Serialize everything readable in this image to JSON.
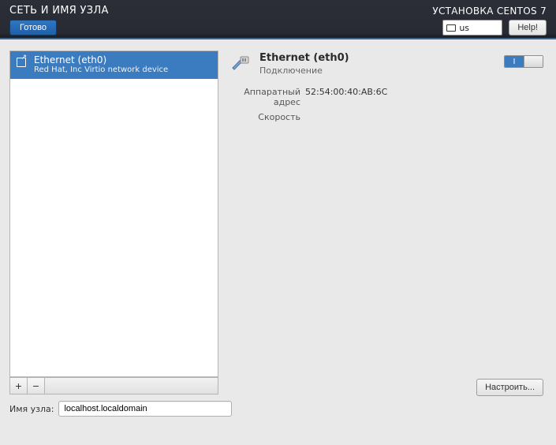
{
  "header": {
    "title": "СЕТЬ И ИМЯ УЗЛА",
    "install_title": "УСТАНОВКА CENTOS 7",
    "done_label": "Готово",
    "help_label": "Help!",
    "kbd_layout": "us"
  },
  "devices": [
    {
      "name": "Ethernet (eth0)",
      "vendor": "Red Hat, Inc Virtio network device"
    }
  ],
  "buttons": {
    "add": "+",
    "remove": "−",
    "configure": "Настроить..."
  },
  "details": {
    "iface_title": "Ethernet (eth0)",
    "status": "Подключение",
    "hw_label": "Аппаратный адрес",
    "hw_value": "52:54:00:40:AB:6C",
    "speed_label": "Скорость",
    "speed_value": ""
  },
  "toggle": {
    "on_label": "I"
  },
  "hostname": {
    "label": "Имя узла:",
    "value": "localhost.localdomain"
  }
}
